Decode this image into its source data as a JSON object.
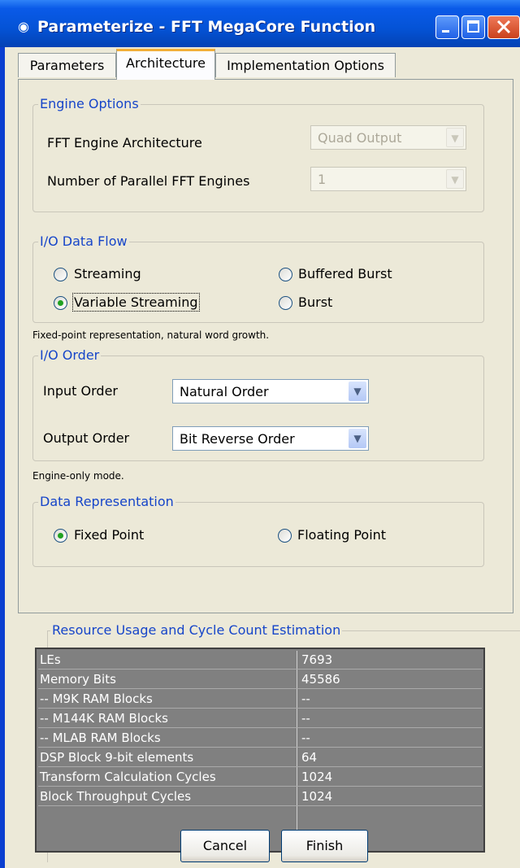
{
  "window": {
    "title": "Parameterize - FFT MegaCore Function"
  },
  "tabs": [
    "Parameters",
    "Architecture",
    "Implementation Options"
  ],
  "engine_options": {
    "legend": "Engine Options",
    "architecture_label": "FFT Engine Architecture",
    "architecture_value": "Quad Output",
    "engines_label": "Number of Parallel FFT Engines",
    "engines_value": "1"
  },
  "io_flow": {
    "legend": "I/O Data Flow",
    "streaming": "Streaming",
    "buffered_burst": "Buffered Burst",
    "variable_streaming": "Variable Streaming",
    "burst": "Burst",
    "selected": "Variable Streaming",
    "note": "Fixed-point representation, natural word growth."
  },
  "io_order": {
    "legend": "I/O Order",
    "input_label": "Input Order",
    "input_value": "Natural Order",
    "output_label": "Output Order",
    "output_value": "Bit Reverse Order",
    "note": "Engine-only mode."
  },
  "data_repr": {
    "legend": "Data Representation",
    "fixed": "Fixed Point",
    "floating": "Floating Point",
    "selected": "Fixed Point"
  },
  "resources": {
    "legend": "Resource Usage and Cycle Count Estimation",
    "rows": [
      [
        "LEs",
        "7693"
      ],
      [
        "Memory Bits",
        "45586"
      ],
      [
        " -- M9K RAM Blocks",
        "--"
      ],
      [
        " -- M144K RAM Blocks",
        "--"
      ],
      [
        " -- MLAB RAM Blocks",
        "--"
      ],
      [
        "DSP Block 9-bit elements",
        "64"
      ],
      [
        "Transform Calculation Cycles",
        "1024"
      ],
      [
        "Block Throughput Cycles",
        "1024"
      ]
    ]
  },
  "buttons": {
    "cancel": "Cancel",
    "finish": "Finish"
  }
}
